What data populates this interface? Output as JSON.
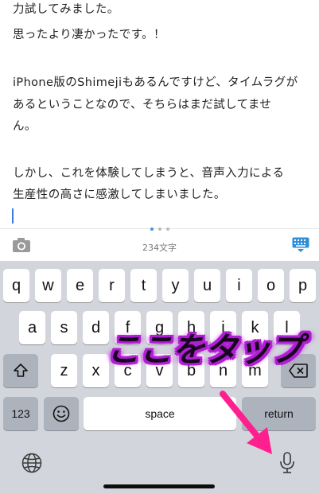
{
  "editor": {
    "lines": [
      "力試してみました。",
      "思ったより凄かったです。！",
      "",
      "iPhone版のShimejiもあるんですけど、タイムラグが",
      "あるということなので、そちらはまだ試してませ",
      "ん。",
      "",
      "しかし、これを体験してしまうと、音声入力による",
      "生産性の高さに感激してしまいました。"
    ]
  },
  "toolbar": {
    "char_count": "234文字",
    "camera_icon": "camera-icon",
    "keyboard_icon": "keyboard-dismiss-icon"
  },
  "keyboard": {
    "row1": [
      "q",
      "w",
      "e",
      "r",
      "t",
      "y",
      "u",
      "i",
      "o",
      "p"
    ],
    "row2": [
      "a",
      "s",
      "d",
      "f",
      "g",
      "h",
      "j",
      "k",
      "l"
    ],
    "row3": [
      "z",
      "x",
      "c",
      "v",
      "b",
      "n",
      "m"
    ],
    "numbers_label": "123",
    "space_label": "space",
    "return_label": "return"
  },
  "annotation": {
    "text": "ここをタップ",
    "color": "#b01fd3",
    "arrow_color": "#ff1f8e"
  },
  "colors": {
    "accent": "#3a7bd5",
    "keyboard_bg": "#d2d5db"
  }
}
